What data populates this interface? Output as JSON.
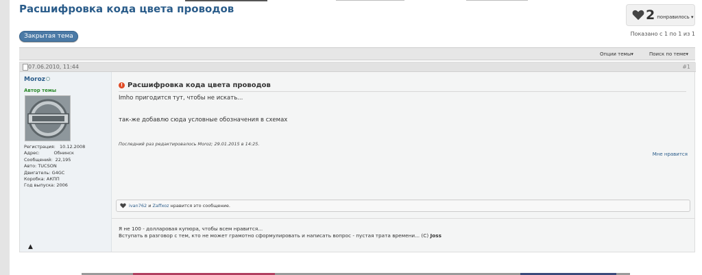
{
  "thread": {
    "title": "Расшифровка кода цвета проводов",
    "likes_count": "2",
    "likes_label": "понравилось ▾",
    "closed_label": "Закрытая тема",
    "shown_text": "Показано с 1 по 1 из 1"
  },
  "toolbar": {
    "options_label": "Опции темы▾",
    "search_label": "Поиск по теме▾"
  },
  "post": {
    "date": "07.06.2010, 11:44",
    "number": "#1",
    "author": {
      "name": "Moroz",
      "title": "Автор темы",
      "info": [
        {
          "label": "Регистрация:",
          "value": "10.12.2008"
        },
        {
          "label": "Адрес:",
          "value": "Обнинск"
        },
        {
          "label": "Сообщений:",
          "value": "22,195"
        },
        {
          "label": "Авто:",
          "value": "TUCSON"
        },
        {
          "label": "Двигатель:",
          "value": "G4GC"
        },
        {
          "label": "Коробка:",
          "value": "АКПП"
        },
        {
          "label": "Год выпуска:",
          "value": "2006"
        }
      ]
    },
    "title": "Расшифровка кода цвета проводов",
    "text1": "Imho пригодится тут, чтобы не искать...",
    "text2": "так-же добавлю сюда условные обозначения в схемах",
    "edited": "Последний раз редактировалось Moroz; 29.01.2015 в 14:25.",
    "like_link": "Мне нравится",
    "likes_user1": "ivan762",
    "likes_and": " и ",
    "likes_user2": "Zaffxoz",
    "likes_tail": " нравится это сообщение.",
    "signature_line1": "Я не 100 - долларовая купюра, чтобы всем нравится...",
    "signature_line2_prefix": "Вступать в разговор с тем, кто не может грамотно сформулировать и написать вопрос - пустая трата времени... (С) ",
    "signature_line2_author": "Joss"
  },
  "colors": {
    "title_blue": "#2a5c8a",
    "closed_button": "#4b7aa6",
    "usertitle_green": "#2c8a2c",
    "alert_icon": "#e04a25"
  }
}
